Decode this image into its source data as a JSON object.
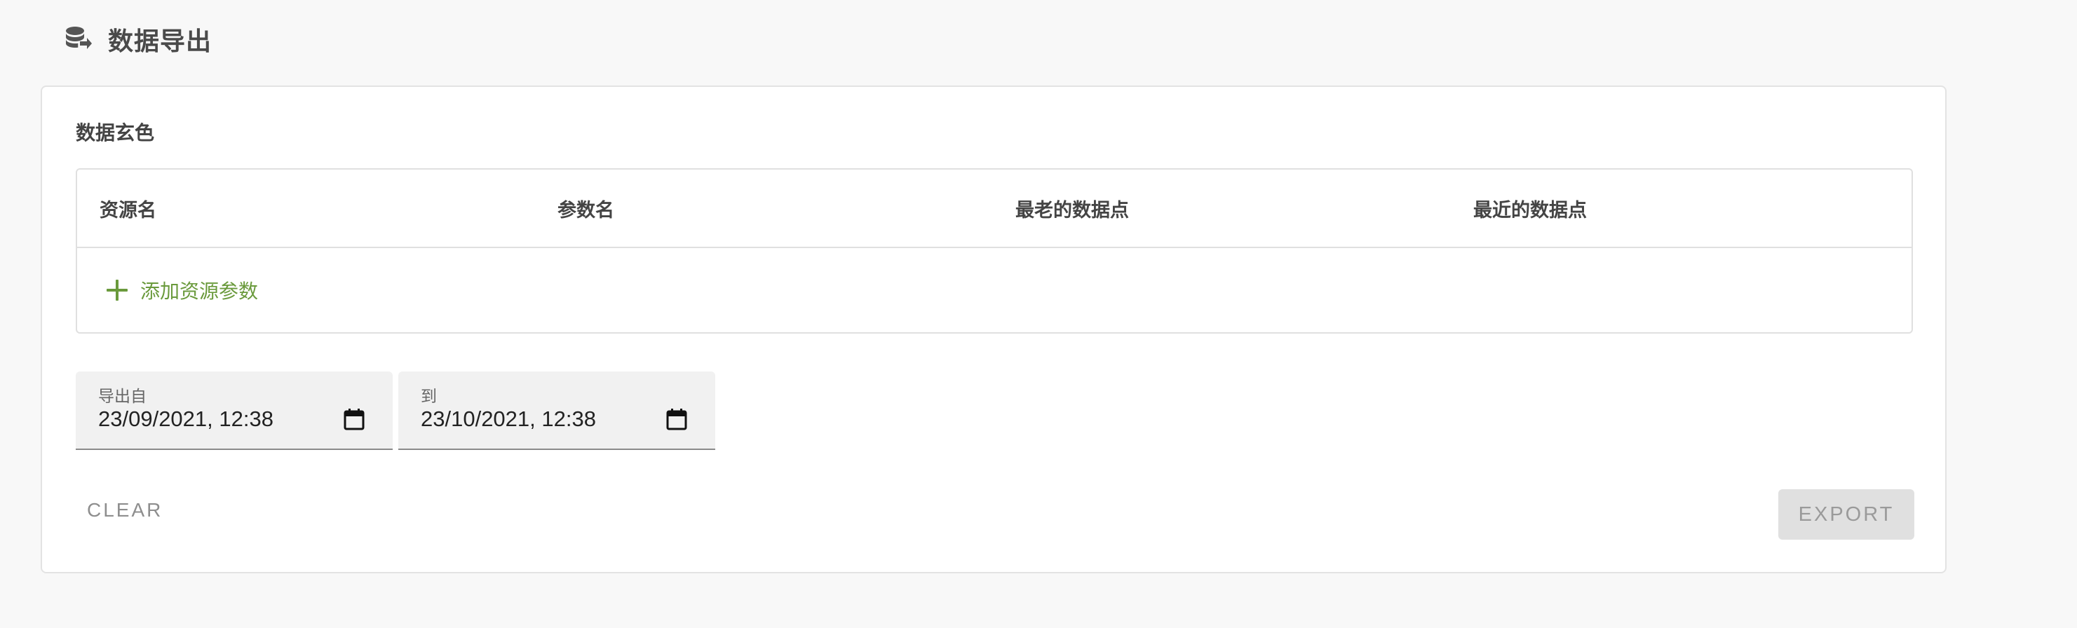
{
  "page": {
    "title": "数据导出",
    "icon": "database-export-icon"
  },
  "section": {
    "title": "数据玄色"
  },
  "table": {
    "columns": [
      "资源名",
      "参数名",
      "最老的数据点",
      "最近的数据点"
    ],
    "add_label": "添加资源参数"
  },
  "date_range": {
    "from": {
      "label": "导出自",
      "value": "23/09/2021, 12:38"
    },
    "to": {
      "label": "到",
      "value": "23/10/2021, 12:38"
    }
  },
  "actions": {
    "clear_label": "CLEAR",
    "export_label": "EXPORT"
  },
  "colors": {
    "accent_green": "#6a9a3c",
    "disabled_bg": "#e0e0e0",
    "disabled_text": "#9a9a9a"
  }
}
